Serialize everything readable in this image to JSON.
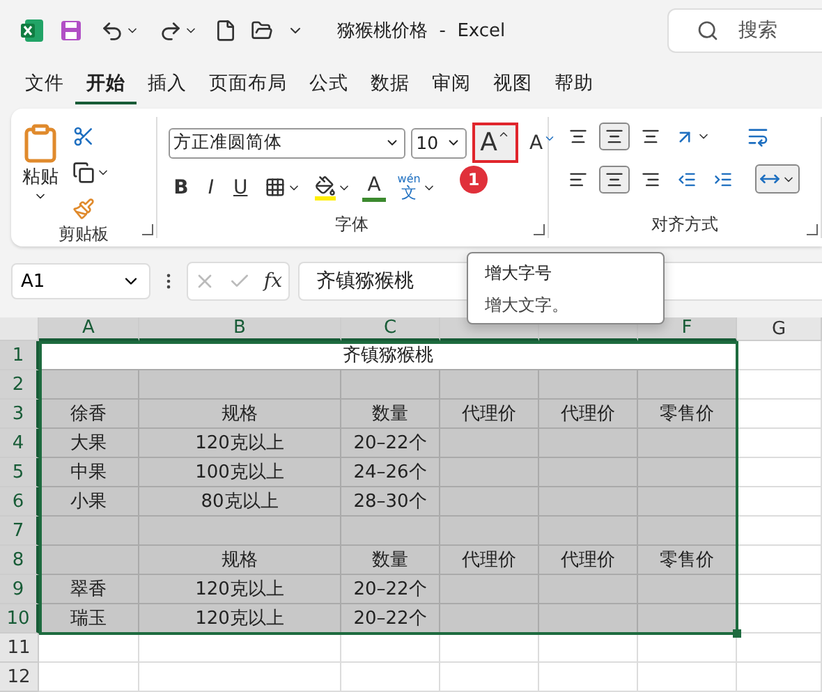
{
  "titlebar": {
    "title": "猕猴桃价格  -  Excel",
    "search": {
      "placeholder": "搜索"
    }
  },
  "menu": [
    {
      "label": "文件",
      "selected": false
    },
    {
      "label": "开始",
      "selected": true
    },
    {
      "label": "插入",
      "selected": false
    },
    {
      "label": "页面布局",
      "selected": false
    },
    {
      "label": "公式",
      "selected": false
    },
    {
      "label": "数据",
      "selected": false
    },
    {
      "label": "审阅",
      "selected": false
    },
    {
      "label": "视图",
      "selected": false
    },
    {
      "label": "帮助",
      "selected": false
    }
  ],
  "ribbon": {
    "clipboard": {
      "paste": "粘贴",
      "label": "剪贴板"
    },
    "font": {
      "name": "方正准圆简体",
      "size": "10",
      "grow": "A",
      "shrink": "A",
      "bold": "B",
      "italic": "I",
      "underline": "U",
      "color_glyph": "A",
      "phonetic_top": "wén",
      "phonetic_bottom": "文",
      "label": "字体",
      "badge": "1"
    },
    "alignment": {
      "label": "对齐方式"
    }
  },
  "tooltip": {
    "title": "增大字号",
    "text": "增大文字。"
  },
  "formula_bar": {
    "cell": "A1",
    "fx": "fx",
    "value": "齐镇猕猴桃"
  },
  "sheet": {
    "columns": [
      {
        "label": "A",
        "selected": true
      },
      {
        "label": "B",
        "selected": true
      },
      {
        "label": "C",
        "selected": true
      },
      {
        "selected": true
      },
      {
        "selected": true
      },
      {
        "label": "F",
        "selected": true
      },
      {
        "label": "G",
        "selected": false
      }
    ],
    "rows": [
      {
        "number": "1",
        "selected": true,
        "title": "齐镇猕猴桃"
      },
      {
        "number": "2",
        "selected": true,
        "shaded": true,
        "cells": {}
      },
      {
        "number": "3",
        "selected": true,
        "shaded": true,
        "cells": {
          "A": "徐香",
          "B": "规格",
          "C": "数量",
          "D": "代理价",
          "E": "代理价",
          "F": "零售价"
        }
      },
      {
        "number": "4",
        "selected": true,
        "shaded": true,
        "cells": {
          "A": "大果",
          "B": "120克以上",
          "C": "20–22个"
        }
      },
      {
        "number": "5",
        "selected": true,
        "shaded": true,
        "cells": {
          "A": "中果",
          "B": "100克以上",
          "C": "24–26个"
        }
      },
      {
        "number": "6",
        "selected": true,
        "shaded": true,
        "cells": {
          "A": "小果",
          "B": "80克以上",
          "C": "28–30个"
        }
      },
      {
        "number": "7",
        "selected": true,
        "shaded": true,
        "cells": {}
      },
      {
        "number": "8",
        "selected": true,
        "shaded": true,
        "cells": {
          "B": "规格",
          "C": "数量",
          "D": "代理价",
          "E": "代理价",
          "F": "零售价"
        }
      },
      {
        "number": "9",
        "selected": true,
        "shaded": true,
        "cells": {
          "A": "翠香",
          "B": "120克以上",
          "C": "20–22个"
        }
      },
      {
        "number": "10",
        "selected": true,
        "shaded": true,
        "cells": {
          "A": "瑞玉",
          "B": "120克以上",
          "C": "20–22个"
        }
      },
      {
        "number": "11",
        "selected": false,
        "shaded": false,
        "cells": {}
      },
      {
        "number": "12",
        "selected": false,
        "shaded": false,
        "cells": {}
      }
    ]
  }
}
